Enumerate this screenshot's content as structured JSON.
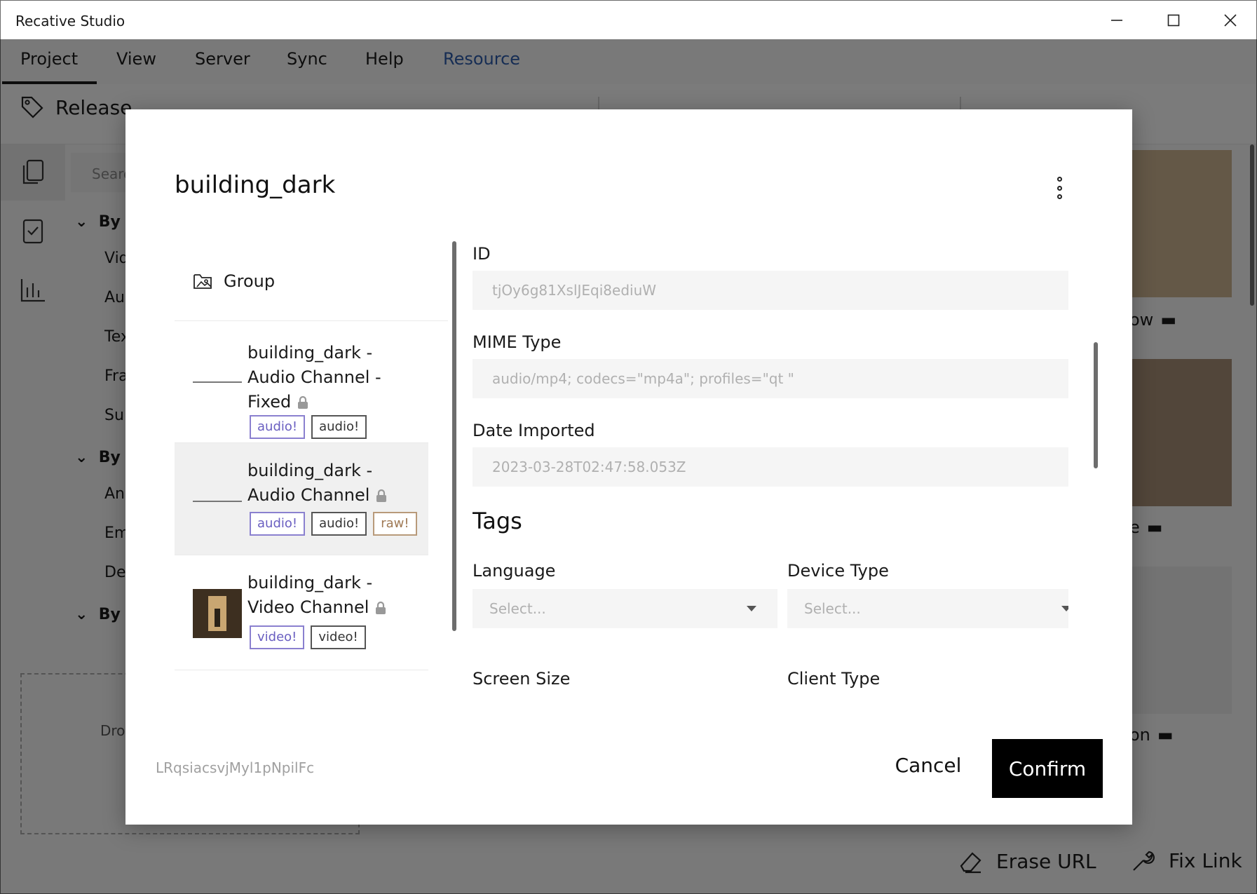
{
  "window": {
    "title": "Recative Studio"
  },
  "menu": {
    "items": [
      "Project",
      "View",
      "Server",
      "Sync",
      "Help",
      "Resource"
    ]
  },
  "toolbar": {
    "release_label": "Release"
  },
  "tree": {
    "search_placeholder": "Search",
    "group1": "By",
    "group1_items": [
      "Vid",
      "Au",
      "Tex",
      "Fra",
      "Su"
    ],
    "group2": "By",
    "group2_items": [
      "An",
      "Em",
      "De"
    ],
    "group3": "By",
    "drop_text": "Drop"
  },
  "thumbs": {
    "label1": "ow",
    "label2": "e",
    "label3": "on"
  },
  "status": {
    "erase_url": "Erase URL",
    "fix_link": "Fix Link"
  },
  "dialog": {
    "title": "building_dark",
    "group_label": "Group",
    "channels": [
      {
        "title": "building_dark - Audio Channel - Fixed",
        "tags": [
          "audio!",
          "audio!"
        ]
      },
      {
        "title": "building_dark - Audio Channel",
        "tags": [
          "audio!",
          "audio!",
          "raw!"
        ]
      },
      {
        "title": "building_dark - Video Channel",
        "tags": [
          "video!",
          "video!"
        ]
      }
    ],
    "fields": {
      "id_label": "ID",
      "id_value": "tjOy6g81XslJEqi8ediuW",
      "mime_label": "MIME Type",
      "mime_value": "audio/mp4; codecs=\"mp4a\"; profiles=\"qt  \"",
      "date_label": "Date Imported",
      "date_value": "2023-03-28T02:47:58.053Z"
    },
    "tags_section": "Tags",
    "tag_fields": {
      "language_label": "Language",
      "language_placeholder": "Select...",
      "device_label": "Device Type",
      "device_placeholder": "Select...",
      "screen_label": "Screen Size",
      "client_label": "Client Type"
    },
    "footer_id": "LRqsiacsvjMyl1pNpilFc",
    "cancel_label": "Cancel",
    "confirm_label": "Confirm"
  }
}
